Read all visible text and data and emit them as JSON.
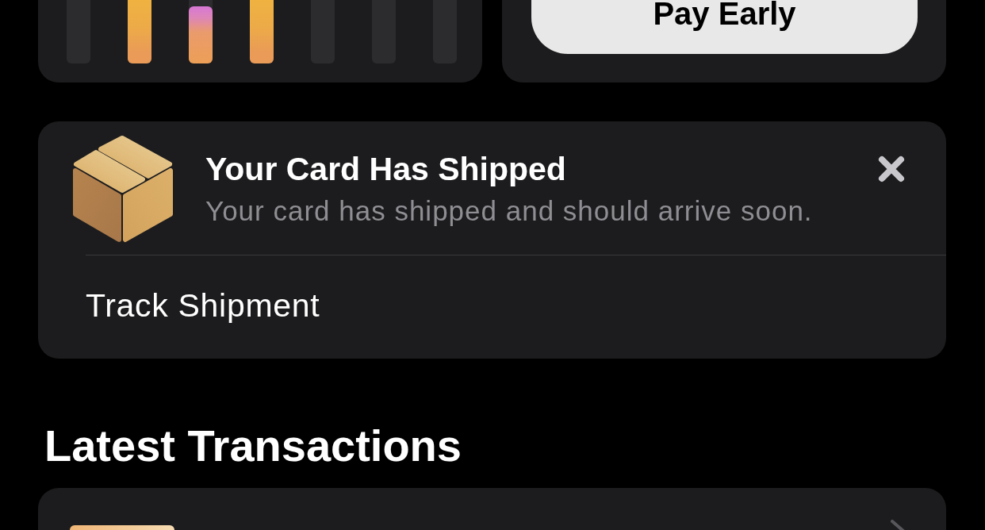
{
  "payment_card": {
    "button": "Pay Early"
  },
  "notification": {
    "title": "Your Card Has Shipped",
    "message": "Your card has shipped and should arrive soon.",
    "action": "Track Shipment"
  },
  "transactions": {
    "heading": "Latest Transactions"
  }
}
